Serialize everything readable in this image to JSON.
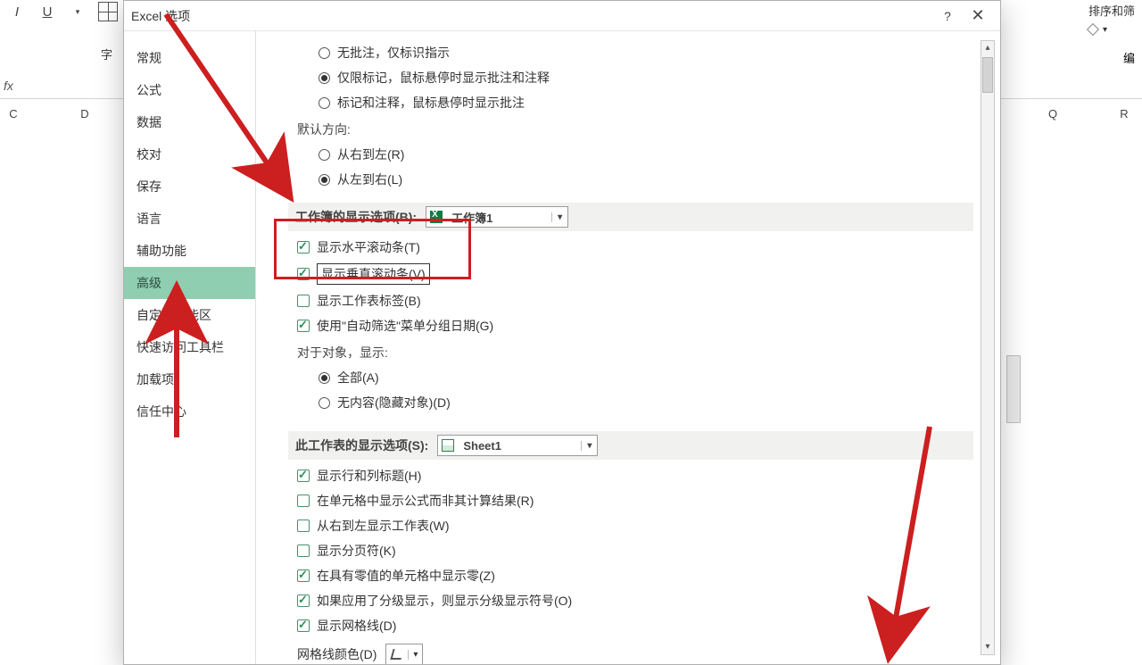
{
  "dialog_title": "Excel 选项",
  "help_char": "?",
  "close_char": "✕",
  "ribbon": {
    "italic": "I",
    "underline": "U",
    "font_group_label": "字",
    "sort_filter": "排序和筛",
    "edit_label": "编"
  },
  "columns": {
    "c": "C",
    "d": "D",
    "q": "Q",
    "r": "R"
  },
  "fx": "fx",
  "sidebar": {
    "items": [
      {
        "label": "常规"
      },
      {
        "label": "公式"
      },
      {
        "label": "数据"
      },
      {
        "label": "校对"
      },
      {
        "label": "保存"
      },
      {
        "label": "语言"
      },
      {
        "label": "辅助功能"
      },
      {
        "label": "高级"
      },
      {
        "label": "自定义功能区"
      },
      {
        "label": "快速访问工具栏"
      },
      {
        "label": "加载项"
      },
      {
        "label": "信任中心"
      }
    ],
    "active_index": 7
  },
  "panel": {
    "comments": {
      "opt1": "无批注，仅标识指示",
      "opt2": "仅限标记，鼠标悬停时显示批注和注释",
      "opt3": "标记和注释，鼠标悬停时显示批注"
    },
    "default_direction": {
      "label": "默认方向:",
      "rtl": "从右到左(R)",
      "ltr": "从左到右(L)"
    },
    "workbook_display": {
      "label": "工作簿的显示选项(B):",
      "combo": "工作簿1",
      "hscroll": "显示水平滚动条(T)",
      "vscroll": "显示垂直滚动条(V)",
      "sheet_tabs": "显示工作表标签(B)",
      "autofilter_group": "使用\"自动筛选\"菜单分组日期(G)"
    },
    "objects": {
      "label": "对于对象，显示:",
      "all": "全部(A)",
      "none": "无内容(隐藏对象)(D)"
    },
    "sheet_display": {
      "label": "此工作表的显示选项(S):",
      "combo": "Sheet1",
      "row_col_headers": "显示行和列标题(H)",
      "show_formulas": "在单元格中显示公式而非其计算结果(R)",
      "rtl_sheet": "从右到左显示工作表(W)",
      "page_breaks": "显示分页符(K)",
      "show_zero": "在具有零值的单元格中显示零(Z)",
      "outline_symbols": "如果应用了分级显示，则显示分级显示符号(O)",
      "gridlines": "显示网格线(D)",
      "grid_color": "网格线颜色(D)"
    }
  }
}
